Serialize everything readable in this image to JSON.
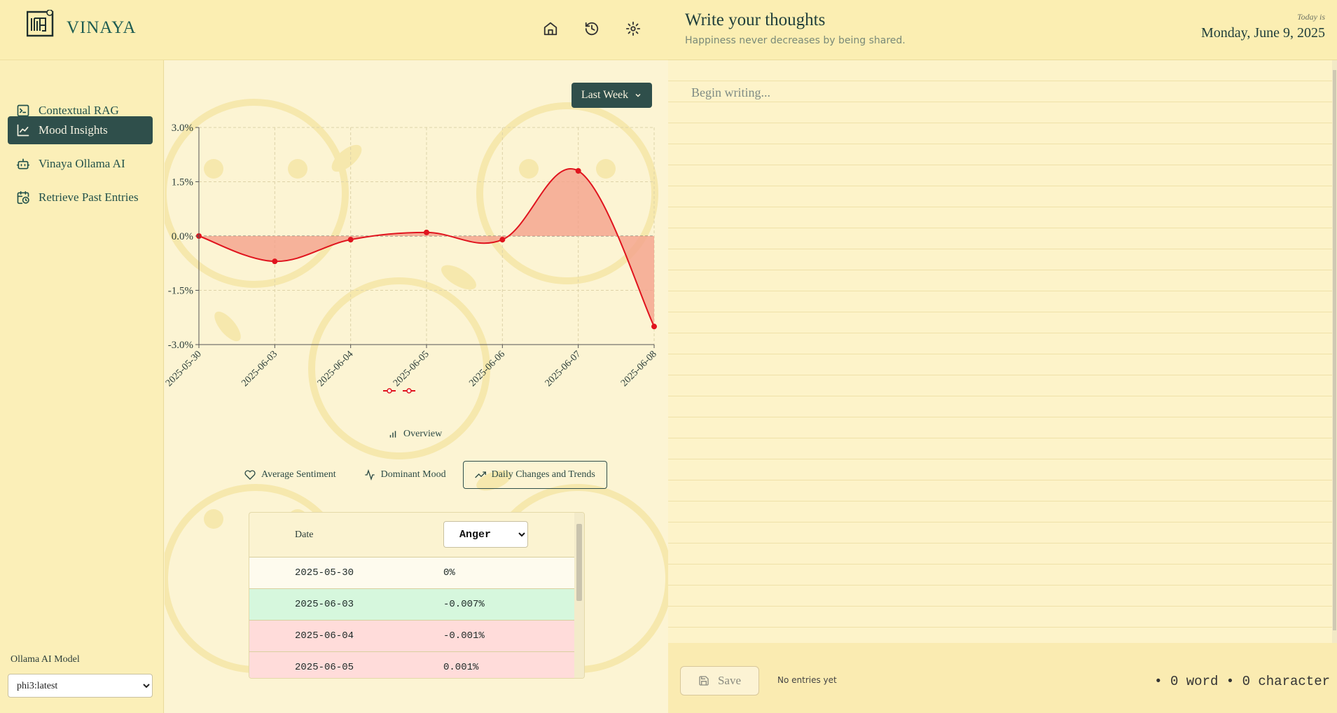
{
  "app": {
    "brand": "VINAYA"
  },
  "topnav": {
    "icons": [
      "home-icon",
      "history-icon",
      "settings-icon"
    ]
  },
  "sidebar": {
    "items": [
      {
        "label": "Contextual RAG",
        "icon": "terminal-icon",
        "active": false
      },
      {
        "label": "Mood Insights",
        "icon": "line-chart-icon",
        "active": true
      },
      {
        "label": "Vinaya Ollama AI",
        "icon": "bot-icon",
        "active": false
      },
      {
        "label": "Retrieve Past Entries",
        "icon": "calendar-clock-icon",
        "active": false
      }
    ],
    "model_label": "Ollama AI Model",
    "model_selected": "phi3:latest"
  },
  "insights": {
    "range_button": "Last Week",
    "overview_label": "Overview",
    "tabs": [
      {
        "label": "Average Sentiment",
        "icon": "heart-icon",
        "active": false
      },
      {
        "label": "Dominant Mood",
        "icon": "activity-icon",
        "active": false
      },
      {
        "label": "Daily Changes and Trends",
        "icon": "trending-up-icon",
        "active": true
      }
    ],
    "table": {
      "date_header": "Date",
      "emotion_selected": "Anger",
      "rows": [
        {
          "date": "2025-05-30",
          "value": "0%",
          "color": "#fefbee"
        },
        {
          "date": "2025-06-03",
          "value": "-0.007%",
          "color": "#d6f7dd"
        },
        {
          "date": "2025-06-04",
          "value": "-0.001%",
          "color": "#ffdcda"
        },
        {
          "date": "2025-06-05",
          "value": "0.001%",
          "color": "#ffdcda"
        }
      ]
    }
  },
  "chart_data": {
    "type": "area",
    "categories": [
      "2025-05-30",
      "2025-06-03",
      "2025-06-04",
      "2025-06-05",
      "2025-06-06",
      "2025-06-07",
      "2025-06-08"
    ],
    "series": [
      {
        "values": [
          0.0,
          -0.7,
          -0.1,
          0.1,
          -0.1,
          1.8,
          -2.5
        ],
        "color": "#e0141e",
        "fill": "#f4a18c"
      }
    ],
    "yticks": [
      "3.0%",
      "1.5%",
      "0.0%",
      "-1.5%",
      "-3.0%"
    ],
    "ylim": [
      -3.0,
      3.0
    ],
    "grid": true,
    "xlabel": "",
    "ylabel": ""
  },
  "journal": {
    "title": "Write your thoughts",
    "subtitle": "Happiness never decreases by being shared.",
    "today_label": "Today is",
    "date": "Monday, June 9, 2025",
    "placeholder": "Begin writing...",
    "save_label": "Save",
    "status": "No entries yet",
    "counts": "• 0 word  • 0 character"
  }
}
